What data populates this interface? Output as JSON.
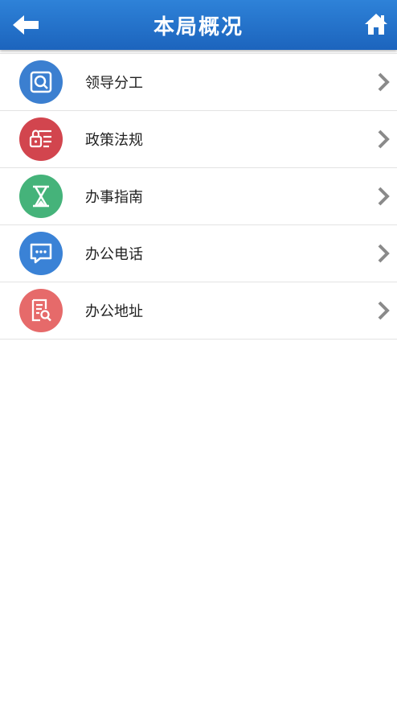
{
  "header": {
    "title": "本局概况"
  },
  "menu": {
    "items": [
      {
        "label": "领导分工",
        "icon": "search-doc-icon",
        "color": "#3b7fd0"
      },
      {
        "label": "政策法规",
        "icon": "lock-list-icon",
        "color": "#d2454e"
      },
      {
        "label": "办事指南",
        "icon": "hourglass-icon",
        "color": "#45b37a"
      },
      {
        "label": "办公电话",
        "icon": "message-icon",
        "color": "#3a82d6"
      },
      {
        "label": "办公地址",
        "icon": "doc-search-icon",
        "color": "#e66a6a"
      }
    ]
  }
}
